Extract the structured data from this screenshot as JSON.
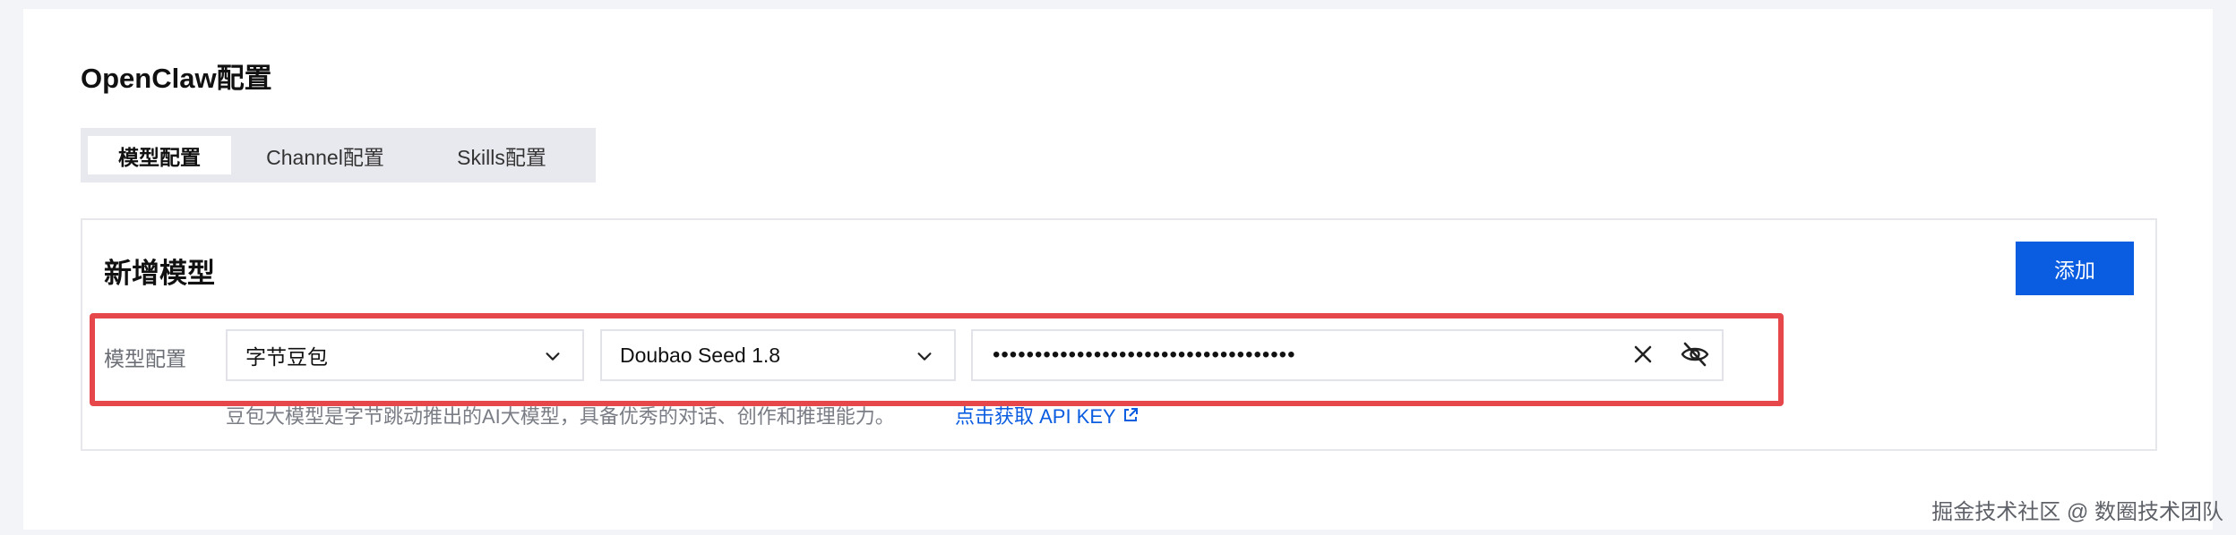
{
  "page": {
    "title": "OpenClaw配置"
  },
  "tabs": [
    {
      "label": "模型配置",
      "active": true
    },
    {
      "label": "Channel配置",
      "active": false
    },
    {
      "label": "Skills配置",
      "active": false
    }
  ],
  "panel": {
    "title": "新增模型",
    "add_button": "添加",
    "row_label": "模型配置",
    "provider_select": {
      "value": "字节豆包"
    },
    "model_select": {
      "value": "Doubao Seed 1.8"
    },
    "api_key": {
      "value": "••••••••••••••••••••••••••••••••••••"
    },
    "hint": "豆包大模型是字节跳动推出的AI大模型，具备优秀的对话、创作和推理能力。",
    "hint_link": "点击获取 API KEY"
  },
  "watermark": "掘金技术社区 @ 数圈技术团队",
  "colors": {
    "accent": "#0a5ce0",
    "highlight": "#e5474b"
  },
  "icons": {
    "provider_chevron": "chevron-down-icon",
    "model_chevron": "chevron-down-icon",
    "clear": "close-icon",
    "toggle_visibility": "eye-off-icon",
    "external_link": "external-link-icon"
  }
}
